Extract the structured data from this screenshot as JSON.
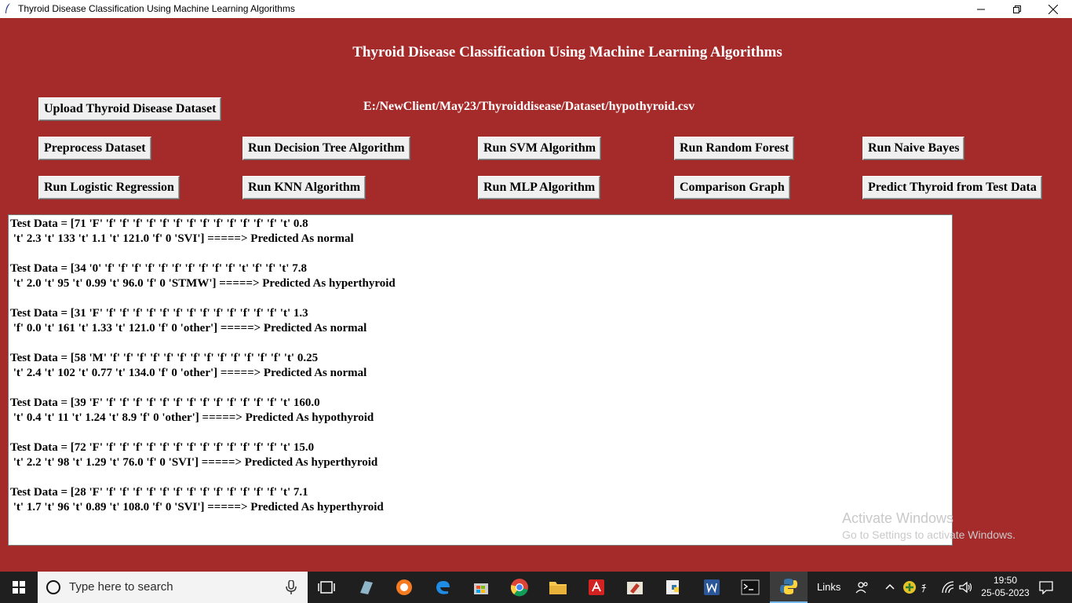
{
  "window": {
    "title": "Thyroid Disease Classification Using Machine Learning Algorithms"
  },
  "app": {
    "heading": "Thyroid Disease Classification Using Machine Learning Algorithms",
    "dataset_path": "E:/NewClient/May23/Thyroiddisease/Dataset/hypothyroid.csv",
    "buttons": {
      "upload": "Upload Thyroid Disease Dataset",
      "preprocess": "Preprocess Dataset",
      "decision_tree": "Run Decision Tree Algorithm",
      "svm": "Run SVM Algorithm",
      "random_forest": "Run Random Forest",
      "naive_bayes": "Run Naive Bayes",
      "logistic": "Run Logistic Regression",
      "knn": "Run KNN Algorithm",
      "mlp": "Run MLP Algorithm",
      "comparison": "Comparison Graph",
      "predict": "Predict Thyroid from Test Data"
    },
    "output_lines": [
      "Test Data = [71 'F' 'f' 'f' 'f' 'f' 'f' 'f' 'f' 'f' 'f' 'f' 'f' 'f' 'f' 't' 0.8\n 't' 2.3 't' 133 't' 1.1 't' 121.0 'f' 0 'SVI'] =====> Predicted As normal",
      "Test Data = [34 '0' 'f' 'f' 'f' 'f' 'f' 'f' 'f' 'f' 'f' 'f' 't' 'f' 'f' 't' 7.8\n 't' 2.0 't' 95 't' 0.99 't' 96.0 'f' 0 'STMW'] =====> Predicted As hyperthyroid",
      "Test Data = [31 'F' 'f' 'f' 'f' 'f' 'f' 'f' 'f' 'f' 'f' 'f' 'f' 'f' 'f' 't' 1.3\n 'f' 0.0 't' 161 't' 1.33 't' 121.0 'f' 0 'other'] =====> Predicted As normal",
      "Test Data = [58 'M' 'f' 'f' 'f' 'f' 'f' 'f' 'f' 'f' 'f' 'f' 'f' 'f' 'f' 't' 0.25\n 't' 2.4 't' 102 't' 0.77 't' 134.0 'f' 0 'other'] =====> Predicted As normal",
      "Test Data = [39 'F' 'f' 'f' 'f' 'f' 'f' 'f' 'f' 'f' 'f' 'f' 'f' 'f' 'f' 't' 160.0\n 't' 0.4 't' 11 't' 1.24 't' 8.9 'f' 0 'other'] =====> Predicted As hypothyroid",
      "Test Data = [72 'F' 'f' 'f' 'f' 'f' 'f' 'f' 'f' 'f' 'f' 'f' 'f' 'f' 'f' 't' 15.0\n 't' 2.2 't' 98 't' 1.29 't' 76.0 'f' 0 'SVI'] =====> Predicted As hyperthyroid",
      "Test Data = [28 'F' 'f' 'f' 'f' 'f' 'f' 'f' 'f' 'f' 'f' 'f' 'f' 'f' 'f' 't' 7.1\n 't' 1.7 't' 96 't' 0.89 't' 108.0 'f' 0 'SVI'] =====> Predicted As hyperthyroid"
    ],
    "colors": {
      "background": "#a52a2a",
      "text_light": "#ffffff",
      "button_face": "#f0f0f0",
      "output_bg": "#ffffff"
    }
  },
  "watermark": {
    "line1": "Activate Windows",
    "line2": "Go to Settings to activate Windows."
  },
  "taskbar": {
    "search_placeholder": "Type here to search",
    "links_label": "Links",
    "time": "19:50",
    "date": "25-05-2023",
    "icons": [
      "windows-start-icon",
      "search-icon",
      "microphone-icon",
      "task-view-icon",
      "store-app-icon",
      "avast-icon",
      "edge-icon",
      "store-icon",
      "chrome-icon",
      "file-explorer-icon",
      "acrobat-icon",
      "paint-icon",
      "python-idle-icon",
      "word-icon",
      "terminal-icon",
      "python-icon",
      "people-icon",
      "chevron-up-icon",
      "antivirus-tray-icon",
      "ime-icon",
      "wifi-icon",
      "volume-icon",
      "notifications-icon"
    ]
  }
}
